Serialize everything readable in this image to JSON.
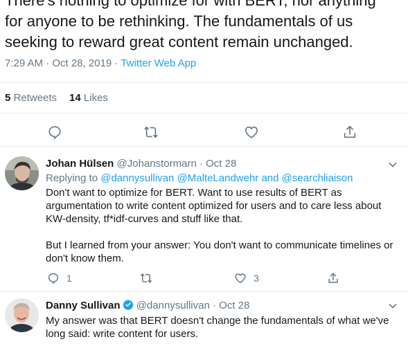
{
  "main_tweet": {
    "text_lines": [
      "There's nothing to optimize for with BERT, nor anything",
      "for anyone to be rethinking. The fundamentals of us",
      "seeking to reward great content remain unchanged."
    ],
    "timestamp": "7:29 AM · Oct 28, 2019 · ",
    "source": "Twitter Web App",
    "retweets_count": "5",
    "retweets_label": "Retweets",
    "likes_count": "14",
    "likes_label": "Likes"
  },
  "replies": [
    {
      "name": "Johan Hülsen",
      "handle": "@Johanstormarn",
      "date": " · Oct 28",
      "replying_prefix": "Replying to ",
      "replying_handles": "@dannysullivan @MalteLandwehr and @searchliaison",
      "body_lines": [
        "Don't want to optimize for BERT. Want to use results of BERT as",
        "argumentation to write content optimized for users and to care less about",
        "KW-density, tf*idf-curves and stuff like that.",
        "",
        "But I learned from your answer: You don't want to communicate timelines or",
        "don't know them."
      ],
      "reply_count": "1",
      "like_count": "3"
    },
    {
      "name": "Danny Sullivan",
      "handle": "@dannysullivan",
      "date": " · Oct 28",
      "body_lines": [
        "My answer was that BERT doesn't change the fundamentals of what we've",
        "long said: write content for users."
      ]
    }
  ],
  "icons": {
    "reply": "reply-icon",
    "retweet": "retweet-icon",
    "like": "heart-icon",
    "share": "share-icon",
    "caret": "chevron-down-icon",
    "verified": "verified-badge-icon"
  },
  "colors": {
    "link": "#1da1f2",
    "secondary_text": "#657786",
    "primary_text": "#14171a",
    "divider": "#e6ecf0"
  }
}
